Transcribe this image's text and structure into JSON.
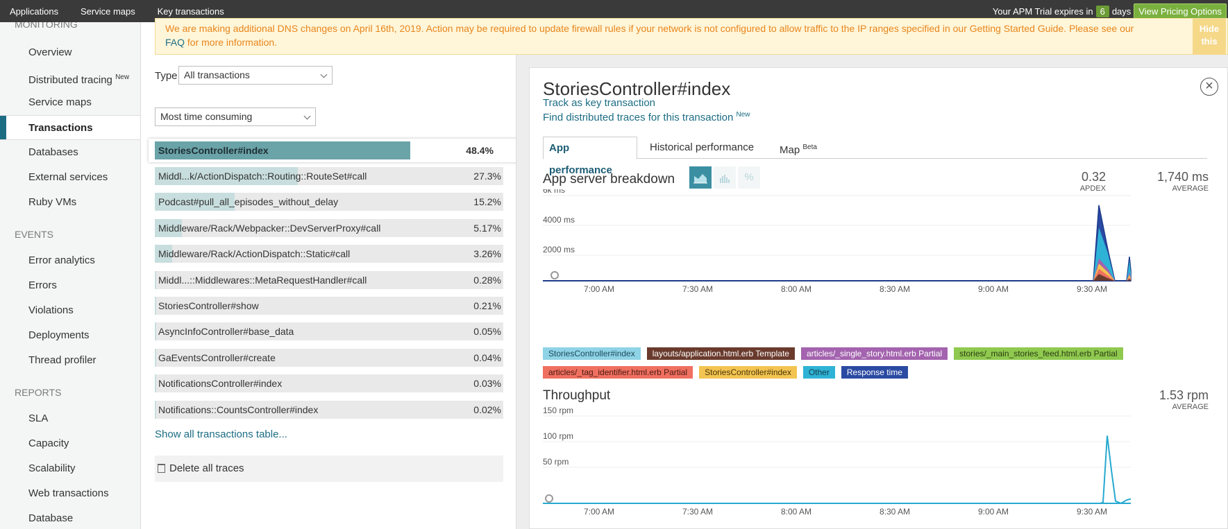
{
  "topbar": {
    "nav": [
      "Applications",
      "Service maps",
      "Key transactions"
    ],
    "trial_prefix": "Your APM Trial expires in",
    "trial_days": "6",
    "trial_suffix": "days",
    "pricing_button": "View Pricing Options"
  },
  "sidebar": {
    "monitoring_header": "MONITORING",
    "monitoring_items": [
      {
        "label": "Overview"
      },
      {
        "label": "Distributed tracing",
        "badge": "New"
      },
      {
        "label": "Service maps"
      },
      {
        "label": "Transactions",
        "active": true
      },
      {
        "label": "Databases"
      },
      {
        "label": "External services"
      },
      {
        "label": "Ruby VMs"
      }
    ],
    "events_header": "EVENTS",
    "events_items": [
      "Error analytics",
      "Errors",
      "Violations",
      "Deployments",
      "Thread profiler"
    ],
    "reports_header": "REPORTS",
    "reports_items": [
      "SLA",
      "Capacity",
      "Scalability",
      "Web transactions",
      "Database"
    ]
  },
  "banner": {
    "text_before": "We are making additional DNS changes on April 16th, 2019. Action may be required to update firewall rules if your network is not configured to allow traffic to the IP ranges specified in our Getting Started Guide. Please see our ",
    "faq_link": "FAQ",
    "text_after": " for more information.",
    "hide_button_line1": "Hide",
    "hide_button_line2": "this"
  },
  "filters": {
    "type_label": "Type",
    "type_value": "All transactions",
    "sort_value": "Most time consuming"
  },
  "transactions": [
    {
      "name": "StoriesController#index",
      "pct": "48.4%",
      "share": 0.484,
      "selected": true
    },
    {
      "name": "Middl...k/ActionDispatch::Routing::RouteSet#call",
      "pct": "27.3%",
      "share": 0.273
    },
    {
      "name": "Podcast#pull_all_episodes_without_delay",
      "pct": "15.2%",
      "share": 0.152
    },
    {
      "name": "Middleware/Rack/Webpacker::DevServerProxy#call",
      "pct": "5.17%",
      "share": 0.0517
    },
    {
      "name": "Middleware/Rack/ActionDispatch::Static#call",
      "pct": "3.26%",
      "share": 0.0326
    },
    {
      "name": "Middl...::Middlewares::MetaRequestHandler#call",
      "pct": "0.28%",
      "share": 0.0028
    },
    {
      "name": "StoriesController#show",
      "pct": "0.21%",
      "share": 0.0021
    },
    {
      "name": "AsyncInfoController#base_data",
      "pct": "0.05%",
      "share": 0.0005
    },
    {
      "name": "GaEventsController#create",
      "pct": "0.04%",
      "share": 0.0004
    },
    {
      "name": "NotificationsController#index",
      "pct": "0.03%",
      "share": 0.0003
    },
    {
      "name": "Notifications::CountsController#index",
      "pct": "0.02%",
      "share": 0.0002
    }
  ],
  "show_all_link": "Show all transactions table...",
  "delete_traces": "Delete all traces",
  "detail": {
    "title": "StoriesController#index",
    "close_icon": "close-icon",
    "key_tx_link": "Track as key transaction",
    "traces_link": "Find distributed traces for this transaction",
    "traces_badge": "New",
    "tabs": [
      {
        "label": "App performance",
        "active": true
      },
      {
        "label": "Historical performance"
      },
      {
        "label": "Map",
        "badge": "Beta"
      }
    ]
  },
  "breakdown": {
    "title": "App server breakdown",
    "view_icons": [
      "area-chart-icon",
      "bar-chart-icon",
      "percent-icon"
    ],
    "percent_glyph": "%",
    "apdex_value": "0.32",
    "apdex_label": "APDEX",
    "avg_value": "1,740 ms",
    "avg_label": "AVERAGE",
    "legend": [
      {
        "label": "StoriesController#index",
        "bg": "#8fd3e6",
        "fg": "#1c4a5a"
      },
      {
        "label": "layouts/application.html.erb Template",
        "bg": "#6a3b2d",
        "fg": "#ffffff"
      },
      {
        "label": "articles/_single_story.html.erb Partial",
        "bg": "#a363ae",
        "fg": "#ffffff"
      },
      {
        "label": "stories/_main_stories_feed.html.erb Partial",
        "bg": "#8fc94f",
        "fg": "#2b3d12"
      },
      {
        "label": "articles/_tag_identifier.html.erb Partial",
        "bg": "#f07060",
        "fg": "#4a1a12"
      },
      {
        "label": "StoriesController#index",
        "bg": "#f3c451",
        "fg": "#4a3508"
      },
      {
        "label": "Other",
        "bg": "#2eb3d6",
        "fg": "#123e4c"
      },
      {
        "label": "Response time",
        "bg": "#2b4aa3",
        "fg": "#ffffff"
      }
    ]
  },
  "throughput": {
    "title": "Throughput",
    "value": "1.53 rpm",
    "label": "AVERAGE"
  },
  "chart_data": [
    {
      "type": "area",
      "title": "App server breakdown",
      "y_ticks": [
        "6k ms",
        "4000 ms",
        "2000 ms"
      ],
      "ylim": [
        0,
        6000
      ],
      "x_ticks": [
        "7:00 AM",
        "7:30 AM",
        "8:00 AM",
        "8:30 AM",
        "9:00 AM",
        "9:30 AM"
      ],
      "x": [
        "9:30",
        "9:31",
        "9:32",
        "9:33",
        "9:34",
        "9:35",
        "9:36",
        "9:37"
      ],
      "series": [
        {
          "name": "Response time",
          "color": "#2b4aa3",
          "values": [
            0,
            4400,
            1800,
            0,
            0,
            0,
            1400,
            600
          ]
        },
        {
          "name": "Other",
          "color": "#2eb3d6",
          "values": [
            0,
            3100,
            1600,
            0,
            0,
            0,
            1200,
            500
          ]
        },
        {
          "name": "articles/_single_story.html.erb Partial",
          "color": "#a363ae",
          "values": [
            0,
            1300,
            700,
            0,
            0,
            0,
            500,
            200
          ]
        },
        {
          "name": "StoriesController#index",
          "color": "#f3c451",
          "values": [
            0,
            1000,
            500,
            0,
            0,
            0,
            350,
            150
          ]
        },
        {
          "name": "articles/_tag_identifier.html.erb Partial",
          "color": "#f07060",
          "values": [
            0,
            700,
            300,
            0,
            0,
            0,
            200,
            80
          ]
        },
        {
          "name": "layouts/application.html.erb Template",
          "color": "#6a3b2d",
          "values": [
            0,
            400,
            150,
            0,
            0,
            0,
            100,
            40
          ]
        }
      ]
    },
    {
      "type": "line",
      "title": "Throughput",
      "y_ticks": [
        "150 rpm",
        "100 rpm",
        "50 rpm"
      ],
      "ylim": [
        0,
        150
      ],
      "x_ticks": [
        "7:00 AM",
        "7:30 AM",
        "8:00 AM",
        "8:30 AM",
        "9:00 AM",
        "9:30 AM"
      ],
      "series": [
        {
          "name": "Throughput",
          "color": "#27a9d0",
          "values": [
            0,
            0,
            0,
            2,
            122,
            60,
            4,
            0,
            6,
            8
          ]
        }
      ]
    }
  ]
}
